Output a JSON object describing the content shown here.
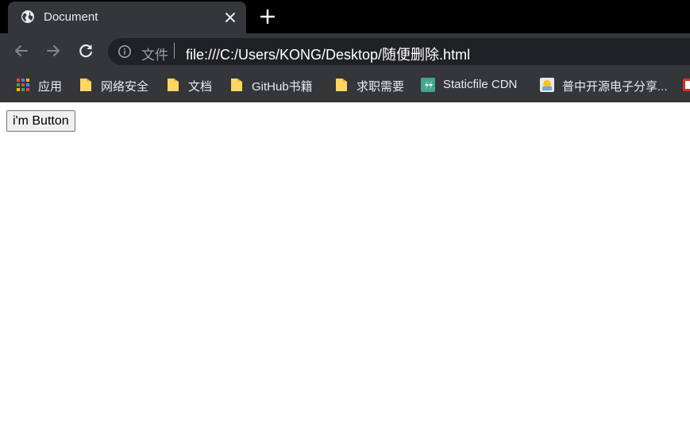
{
  "browser": {
    "tab": {
      "title": "Document",
      "favicon": "globe-icon",
      "close_icon": "close-icon"
    },
    "new_tab_icon": "plus-icon",
    "toolbar": {
      "back_icon": "arrow-left-icon",
      "forward_icon": "arrow-right-icon",
      "reload_icon": "reload-icon",
      "scheme_label": "文件",
      "url": "file:///C:/Users/KONG/Desktop/随便删除.html"
    },
    "bookmarks": [
      {
        "label": "应用",
        "icon": "apps-grid-icon"
      },
      {
        "label": "网络安全",
        "icon": "folder-icon"
      },
      {
        "label": "文档",
        "icon": "folder-icon"
      },
      {
        "label": "GitHub书籍",
        "icon": "folder-icon"
      },
      {
        "label": "求职需要",
        "icon": "folder-icon"
      },
      {
        "label": "Staticfile CDN",
        "icon": "staticfile-icon"
      },
      {
        "label": "普中开源电子分享...",
        "icon": "site-favicon-icon"
      }
    ]
  },
  "page": {
    "button_label": "i'm Button"
  },
  "colors": {
    "tabstrip_bg": "#000000",
    "toolbar_bg": "#35363a",
    "omnibox_bg": "#202124",
    "folder_yellow": "#fdd663"
  }
}
